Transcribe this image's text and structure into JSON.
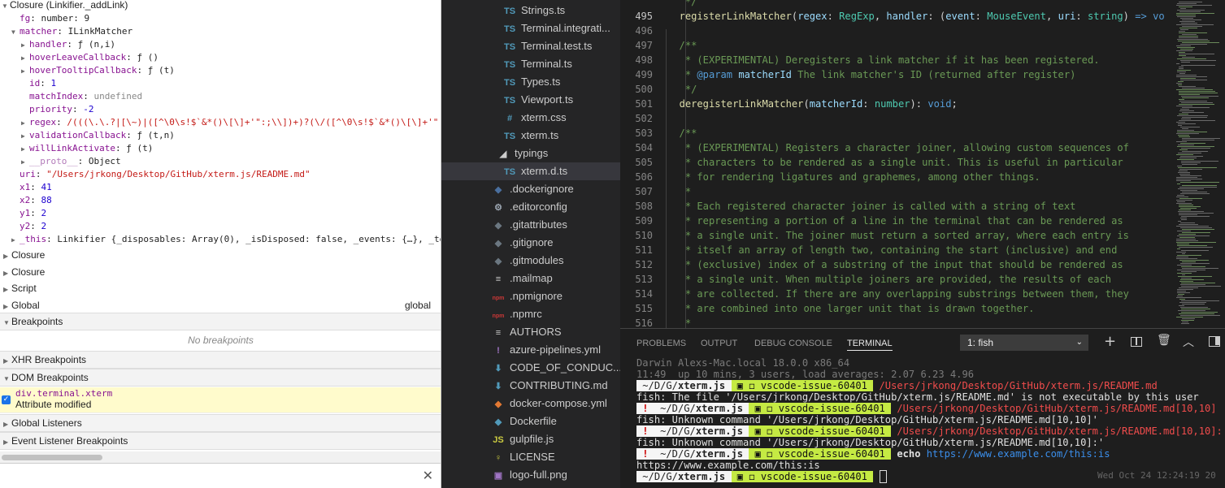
{
  "scope": {
    "closure_title": "Closure (Linkifier._addLink)",
    "props": [
      {
        "indent": 1,
        "exp": "",
        "key": "fg",
        "val": "number: 9",
        "vtype": "vo"
      },
      {
        "indent": 1,
        "exp": "▼",
        "key": "matcher",
        "val": "ILinkMatcher",
        "vtype": "vo"
      },
      {
        "indent": 2,
        "exp": "▶",
        "key": "handler",
        "val": "ƒ (n,i)",
        "vtype": "vf"
      },
      {
        "indent": 2,
        "exp": "▶",
        "key": "hoverLeaveCallback",
        "val": "ƒ ()",
        "vtype": "vf"
      },
      {
        "indent": 2,
        "exp": "▶",
        "key": "hoverTooltipCallback",
        "val": "ƒ (t)",
        "vtype": "vf"
      },
      {
        "indent": 2,
        "exp": "",
        "key": "id",
        "val": "1",
        "vtype": "vn"
      },
      {
        "indent": 2,
        "exp": "",
        "key": "matchIndex",
        "val": "undefined",
        "vtype": "vu"
      },
      {
        "indent": 2,
        "exp": "",
        "key": "priority",
        "val": "-2",
        "vtype": "vn"
      },
      {
        "indent": 2,
        "exp": "▶",
        "key": "regex",
        "val": "/(((\\.\\.?|[\\~)|([^\\0\\s!$`&*()\\[\\]+'\":;\\\\])+)?(\\/([^\\0\\s!$`&*()\\[\\]+'\":;",
        "vtype": "vs"
      },
      {
        "indent": 2,
        "exp": "▶",
        "key": "validationCallback",
        "val": "ƒ (t,n)",
        "vtype": "vf"
      },
      {
        "indent": 2,
        "exp": "▶",
        "key": "willLinkActivate",
        "val": "ƒ (t)",
        "vtype": "vf"
      },
      {
        "indent": 2,
        "exp": "▶",
        "key": "__proto__",
        "val": "Object",
        "vtype": "vo",
        "dim": true
      },
      {
        "indent": 1,
        "exp": "",
        "key": "uri",
        "val": "\"/Users/jrkong/Desktop/GitHub/xterm.js/README.md\"",
        "vtype": "vs"
      },
      {
        "indent": 1,
        "exp": "",
        "key": "x1",
        "val": "41",
        "vtype": "vn"
      },
      {
        "indent": 1,
        "exp": "",
        "key": "x2",
        "val": "88",
        "vtype": "vn"
      },
      {
        "indent": 1,
        "exp": "",
        "key": "y1",
        "val": "2",
        "vtype": "vn"
      },
      {
        "indent": 1,
        "exp": "",
        "key": "y2",
        "val": "2",
        "vtype": "vn"
      },
      {
        "indent": 1,
        "exp": "▶",
        "key": "_this",
        "val": "Linkifier {_disposables: Array(0), _isDisposed: false, _events: {…}, _te",
        "vtype": "vo"
      }
    ],
    "other_scopes": [
      "Closure",
      "Closure",
      "Script",
      "Global"
    ],
    "global_value": "global"
  },
  "sections": {
    "breakpoints": "Breakpoints",
    "no_breakpoints": "No breakpoints",
    "xhr": "XHR Breakpoints",
    "dom": "DOM Breakpoints",
    "dom_entry_selector": "div.terminal.xterm",
    "dom_entry_type": "Attribute modified",
    "global_listeners": "Global Listeners",
    "event_listener": "Event Listener Breakpoints"
  },
  "explorer": [
    {
      "icon": "TS",
      "name": "Strings.ts",
      "color": "#519aba"
    },
    {
      "icon": "TS",
      "name": "Terminal.integrati...",
      "color": "#519aba"
    },
    {
      "icon": "TS",
      "name": "Terminal.test.ts",
      "color": "#519aba"
    },
    {
      "icon": "TS",
      "name": "Terminal.ts",
      "color": "#519aba"
    },
    {
      "icon": "TS",
      "name": "Types.ts",
      "color": "#519aba"
    },
    {
      "icon": "TS",
      "name": "Viewport.ts",
      "color": "#519aba"
    },
    {
      "icon": "#",
      "name": "xterm.css",
      "color": "#519aba"
    },
    {
      "icon": "TS",
      "name": "xterm.ts",
      "color": "#519aba"
    },
    {
      "icon": "◢",
      "name": "typings",
      "color": "#cccccc",
      "folder": true
    },
    {
      "icon": "TS",
      "name": "xterm.d.ts",
      "color": "#519aba",
      "selected": true
    },
    {
      "icon": "◆",
      "name": ".dockerignore",
      "color": "#4a6f9e"
    },
    {
      "icon": "⚙",
      "name": ".editorconfig",
      "color": "#9aa4af"
    },
    {
      "icon": "◆",
      "name": ".gitattributes",
      "color": "#6b7781"
    },
    {
      "icon": "◆",
      "name": ".gitignore",
      "color": "#6b7781"
    },
    {
      "icon": "◆",
      "name": ".gitmodules",
      "color": "#6b7781"
    },
    {
      "icon": "≡",
      "name": ".mailmap",
      "color": "#cccccc"
    },
    {
      "icon": "npm",
      "name": ".npmignore",
      "color": "#cb3837"
    },
    {
      "icon": "npm",
      "name": ".npmrc",
      "color": "#cb3837"
    },
    {
      "icon": "≡",
      "name": "AUTHORS",
      "color": "#cccccc"
    },
    {
      "icon": "!",
      "name": "azure-pipelines.yml",
      "color": "#a074c4"
    },
    {
      "icon": "⬇",
      "name": "CODE_OF_CONDUC...",
      "color": "#519aba"
    },
    {
      "icon": "⬇",
      "name": "CONTRIBUTING.md",
      "color": "#519aba"
    },
    {
      "icon": "◆",
      "name": "docker-compose.yml",
      "color": "#e37933"
    },
    {
      "icon": "◆",
      "name": "Dockerfile",
      "color": "#519aba"
    },
    {
      "icon": "JS",
      "name": "gulpfile.js",
      "color": "#cbcb41"
    },
    {
      "icon": "♀",
      "name": "LICENSE",
      "color": "#cbcb41"
    },
    {
      "icon": "▣",
      "name": "logo-full.png",
      "color": "#a074c4"
    }
  ],
  "editor": {
    "lines": [
      {
        "n": "",
        "html": "<span class='cm'>   */</span>"
      },
      {
        "n": "495",
        "html": "  <span class='cf'>registerLinkMatcher</span>(<span class='cp'>regex</span>: <span class='ct'>RegExp</span>, <span class='cp'>handler</span>: (<span class='cp'>event</span>: <span class='ct'>MouseEvent</span>, <span class='cp'>uri</span>: <span class='ct'>string</span>) <span class='ck'>=&gt;</span> <span class='ck'>vo</span>"
      },
      {
        "n": "496",
        "html": ""
      },
      {
        "n": "497",
        "html": "<span class='cm'>  /**</span>"
      },
      {
        "n": "498",
        "html": "<span class='cm'>   * (EXPERIMENTAL) Deregisters a link matcher if it has been registered.</span>"
      },
      {
        "n": "499",
        "html": "<span class='cm'>   * </span><span class='ck'>@param</span> <span class='cp'>matcherId</span><span class='cm'> The link matcher's ID (returned after register)</span>"
      },
      {
        "n": "500",
        "html": "<span class='cm'>   */</span>"
      },
      {
        "n": "501",
        "html": "  <span class='cf'>deregisterLinkMatcher</span>(<span class='cp'>matcherId</span>: <span class='ct'>number</span>): <span class='ck'>void</span>;"
      },
      {
        "n": "502",
        "html": ""
      },
      {
        "n": "503",
        "html": "<span class='cm'>  /**</span>"
      },
      {
        "n": "504",
        "html": "<span class='cm'>   * (EXPERIMENTAL) Registers a character joiner, allowing custom sequences of</span>"
      },
      {
        "n": "505",
        "html": "<span class='cm'>   * characters to be rendered as a single unit. This is useful in particular</span>"
      },
      {
        "n": "506",
        "html": "<span class='cm'>   * for rendering ligatures and graphemes, among other things.</span>"
      },
      {
        "n": "507",
        "html": "<span class='cm'>   *</span>"
      },
      {
        "n": "508",
        "html": "<span class='cm'>   * Each registered character joiner is called with a string of text</span>"
      },
      {
        "n": "509",
        "html": "<span class='cm'>   * representing a portion of a line in the terminal that can be rendered as</span>"
      },
      {
        "n": "510",
        "html": "<span class='cm'>   * a single unit. The joiner must return a sorted array, where each entry is</span>"
      },
      {
        "n": "511",
        "html": "<span class='cm'>   * itself an array of length two, containing the start (inclusive) and end</span>"
      },
      {
        "n": "512",
        "html": "<span class='cm'>   * (exclusive) index of a substring of the input that should be rendered as</span>"
      },
      {
        "n": "513",
        "html": "<span class='cm'>   * a single unit. When multiple joiners are provided, the results of each</span>"
      },
      {
        "n": "514",
        "html": "<span class='cm'>   * are collected. If there are any overlapping substrings between them, they</span>"
      },
      {
        "n": "515",
        "html": "<span class='cm'>   * are combined into one larger unit that is drawn together.</span>"
      },
      {
        "n": "516",
        "html": "<span class='cm'>   *</span>"
      }
    ]
  },
  "panel": {
    "tabs": [
      "PROBLEMS",
      "OUTPUT",
      "DEBUG CONSOLE",
      "TERMINAL"
    ],
    "active_tab": "TERMINAL",
    "terminal_select": "1: fish",
    "terminal_lines": [
      {
        "html": "<span style='color:#7a7a7a'>Darwin Alexs-Mac.local 18.0.0 x86_64</span>"
      },
      {
        "html": "<span style='color:#7a7a7a'>11:49  up 10 mins, 3 users, load averages: 2.07 6.23 4.96</span>"
      },
      {
        "html": "<span class='pb'> ~/D/G/<b>xterm.js</b> </span><span class='pg'> ▣ ◻ vscode-issue-60401 </span> <span class='pr'>/Users/jrkong/Desktop/GitHub/xterm.js/README.md</span>"
      },
      {
        "html": "fish: The file '/Users/jrkong/Desktop/GitHub/xterm.js/README.md' is not executable by this user"
      },
      {
        "html": "<span class='pb'> <b style='color:#c00'>!</b> </span><span class='pb'> ~/D/G/<b>xterm.js</b> </span><span class='pg'> ▣ ◻ vscode-issue-60401 </span> <span class='pr'>/Users/jrkong/Desktop/GitHub/xterm.js/README.md[10,10]</span>"
      },
      {
        "html": "fish: Unknown command '/Users/jrkong/Desktop/GitHub/xterm.js/README.md[10,10]'"
      },
      {
        "html": "<span class='pb'> <b style='color:#c00'>!</b> </span><span class='pb'> ~/D/G/<b>xterm.js</b> </span><span class='pg'> ▣ ◻ vscode-issue-60401 </span> <span class='pr'>/Users/jrkong/Desktop/GitHub/xterm.js/README.md[10,10]:</span>"
      },
      {
        "html": "fish: Unknown command '/Users/jrkong/Desktop/GitHub/xterm.js/README.md[10,10]:'"
      },
      {
        "html": "<span class='pb'> <b style='color:#c00'>!</b> </span><span class='pb'> ~/D/G/<b>xterm.js</b> </span><span class='pg'> ▣ ◻ vscode-issue-60401 </span> <b>echo</b> <span class='pc'>https://www.example.com/this:is</span>"
      },
      {
        "html": "https://www.example.com/this:is"
      },
      {
        "html": "<span class='pb'> ~/D/G/<b>xterm.js</b> </span><span class='pg'> ▣ ◻ vscode-issue-60401 </span> <span style='border:1px solid #ddd'>&nbsp;</span>"
      }
    ],
    "right_timestamp": "Wed Oct 24 12:24:19 20"
  }
}
